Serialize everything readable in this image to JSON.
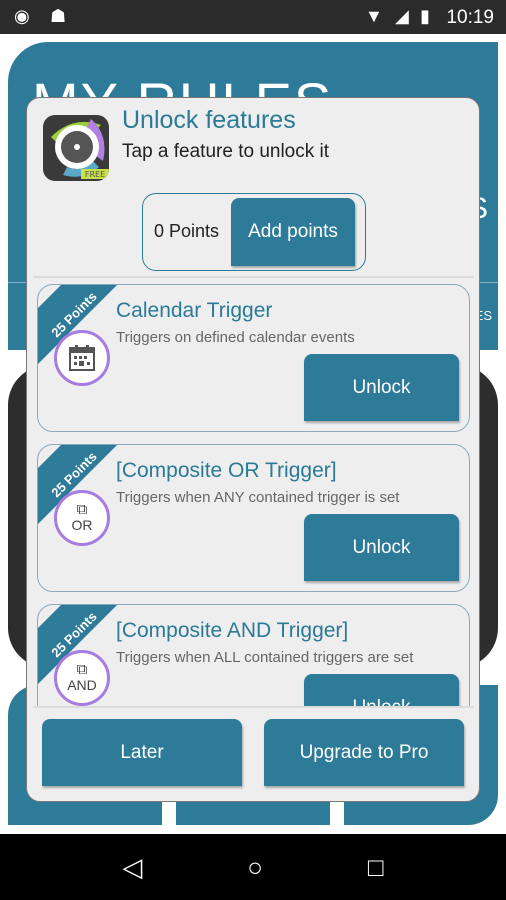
{
  "status": {
    "time": "10:19"
  },
  "background": {
    "title": "MY RULES",
    "partial_right": "S",
    "partial_tab": "ES"
  },
  "dialog": {
    "title": "Unlock features",
    "subtitle": "Tap a feature to unlock it",
    "app_badge": "FREE",
    "points": "0 Points",
    "add_points": "Add points",
    "features": [
      {
        "ribbon": "25 Points",
        "title": "Calendar Trigger",
        "description": "Triggers on defined calendar events",
        "button": "Unlock",
        "icon": "calendar-icon"
      },
      {
        "ribbon": "25 Points",
        "title": "[Composite OR Trigger]",
        "description": "Triggers when ANY contained trigger is set",
        "button": "Unlock",
        "icon_label": "OR",
        "icon": "composite-or-icon"
      },
      {
        "ribbon": "25 Points",
        "title": "[Composite AND Trigger]",
        "description": "Triggers when ALL contained triggers are set",
        "button": "Unlock",
        "icon_label": "AND",
        "icon": "composite-and-icon"
      }
    ],
    "later": "Later",
    "upgrade": "Upgrade to Pro"
  },
  "colors": {
    "accent": "#2e7b99",
    "icon_ring": "#a77be0"
  }
}
